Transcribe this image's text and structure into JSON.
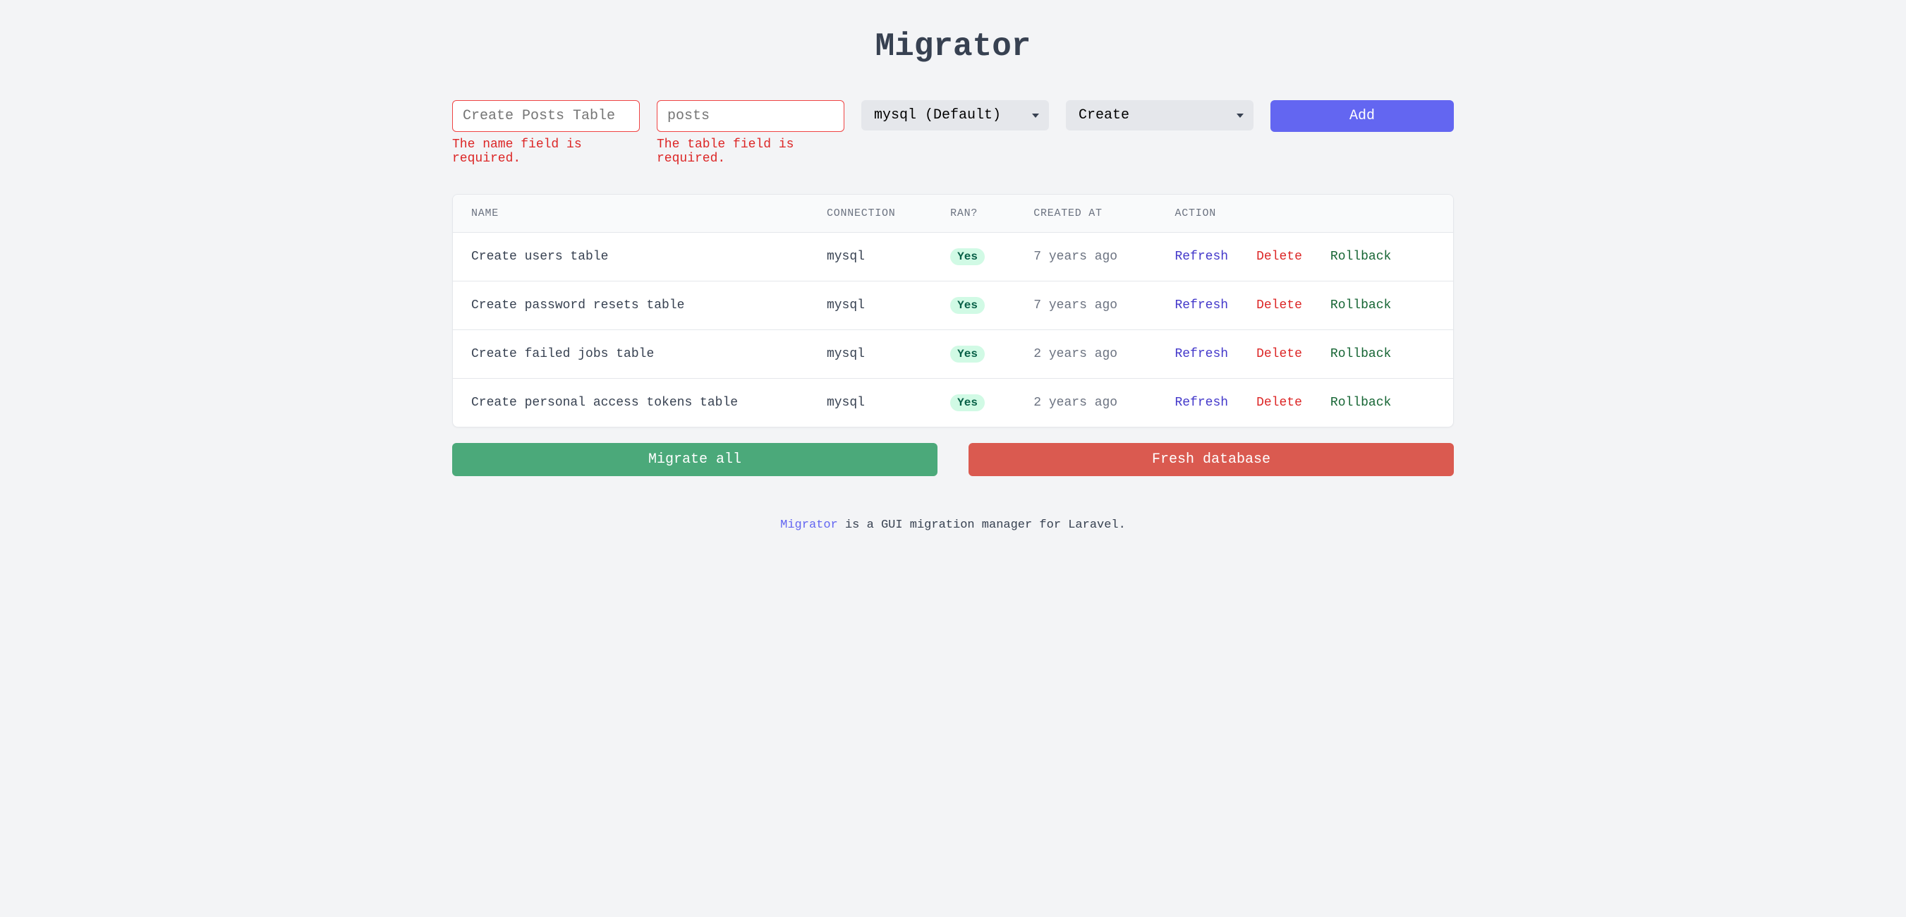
{
  "title": "Migrator",
  "form": {
    "name_placeholder": "Create Posts Table",
    "name_error": "The name field is required.",
    "table_placeholder": "posts",
    "table_error": "The table field is required.",
    "connection_selected": "mysql (Default)",
    "type_selected": "Create",
    "add_label": "Add"
  },
  "table": {
    "headers": {
      "name": "NAME",
      "connection": "CONNECTION",
      "ran": "RAN?",
      "created_at": "CREATED AT",
      "action": "ACTION"
    },
    "action_labels": {
      "refresh": "Refresh",
      "delete": "Delete",
      "rollback": "Rollback"
    },
    "ran_yes": "Yes",
    "rows": [
      {
        "name": "Create users table",
        "connection": "mysql",
        "ran": true,
        "created_at": "7 years ago"
      },
      {
        "name": "Create password resets table",
        "connection": "mysql",
        "ran": true,
        "created_at": "7 years ago"
      },
      {
        "name": "Create failed jobs table",
        "connection": "mysql",
        "ran": true,
        "created_at": "2 years ago"
      },
      {
        "name": "Create personal access tokens table",
        "connection": "mysql",
        "ran": true,
        "created_at": "2 years ago"
      }
    ]
  },
  "buttons": {
    "migrate_all": "Migrate all",
    "fresh_db": "Fresh database"
  },
  "footer": {
    "link_text": "Migrator",
    "rest": " is a GUI migration manager for Laravel."
  }
}
